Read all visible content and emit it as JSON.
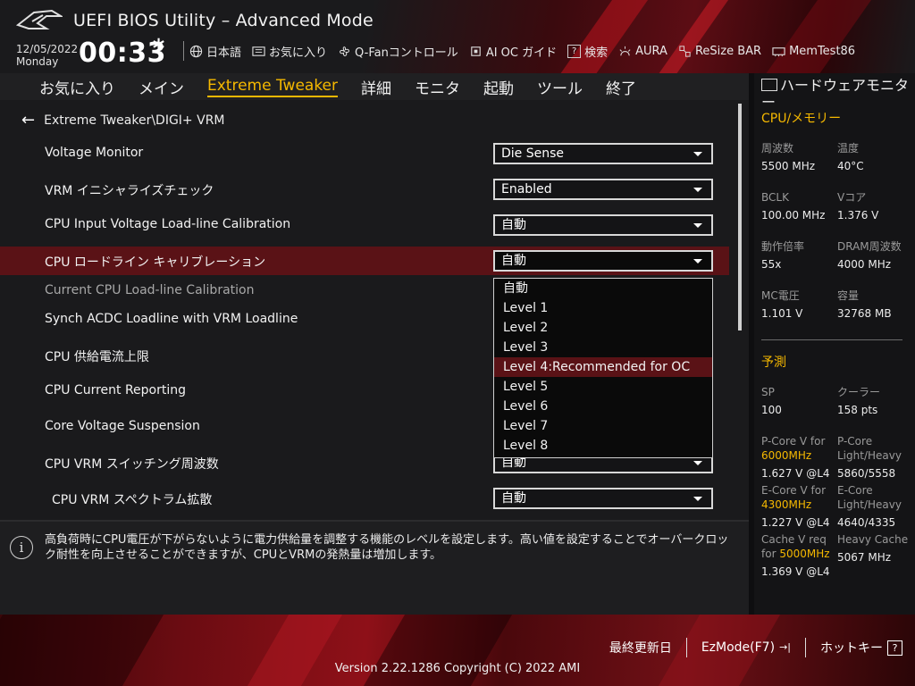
{
  "header": {
    "title": "UEFI BIOS Utility – Advanced Mode",
    "date": "12/05/2022",
    "day": "Monday",
    "time": "00:33",
    "toolbar": [
      {
        "icon": "globe-icon",
        "label": "日本語"
      },
      {
        "icon": "favorites-icon",
        "label": "お気に入り"
      },
      {
        "icon": "fan-icon",
        "label": "Q-Fanコントロール"
      },
      {
        "icon": "ai-oc-icon",
        "label": "AI OC ガイド"
      },
      {
        "icon": "help-box-icon",
        "glyph": "?",
        "label": "検索"
      },
      {
        "icon": "aura-icon",
        "label": "AURA"
      },
      {
        "icon": "resize-bar-icon",
        "label": "ReSize BAR"
      },
      {
        "icon": "memtest-icon",
        "label": "MemTest86"
      }
    ]
  },
  "menu": {
    "tabs": [
      "お気に入り",
      "メイン",
      "Extreme Tweaker",
      "詳細",
      "モニタ",
      "起動",
      "ツール",
      "終了"
    ],
    "active": "Extreme Tweaker"
  },
  "breadcrumb": "Extreme Tweaker\\DIGI+ VRM",
  "settings": [
    {
      "label": "Voltage Monitor",
      "value": "Die Sense"
    },
    {
      "label": "VRM イニシャライズチェック",
      "value": "Enabled"
    },
    {
      "label": "CPU Input Voltage Load-line Calibration",
      "value": "自動"
    },
    {
      "label": "CPU ロードライン キャリブレーション",
      "value": "自動"
    },
    {
      "label": "Current CPU Load-line Calibration",
      "value": ""
    },
    {
      "label": "Synch ACDC Loadline with VRM Loadline",
      "value": ""
    },
    {
      "label": "CPU 供給電流上限",
      "value": ""
    },
    {
      "label": "CPU Current Reporting",
      "value": ""
    },
    {
      "label": "Core Voltage Suspension",
      "value": ""
    },
    {
      "label": "CPU VRM スイッチング周波数",
      "value": "自動"
    },
    {
      "label": "CPU VRM スペクトラム拡散",
      "value": "自動"
    }
  ],
  "dropdown": {
    "options": [
      "自動",
      "Level 1",
      "Level 2",
      "Level 3",
      "Level 4:Recommended for OC",
      "Level 5",
      "Level 6",
      "Level 7",
      "Level 8"
    ],
    "hovered": "Level 4:Recommended for OC"
  },
  "help": {
    "text": "高負荷時にCPU電圧が下がらないように電力供給量を調整する機能のレベルを設定します。高い値を設定することでオーバークロック耐性を向上させることができますが、CPUとVRMの発熱量は増加します。"
  },
  "hardware_monitor": {
    "title": "ハードウェアモニター",
    "section_cpu": "CPU/メモリー",
    "cpu_stats": [
      {
        "k": "周波数",
        "v": "5500 MHz"
      },
      {
        "k": "温度",
        "v": "40°C"
      },
      {
        "k": "BCLK",
        "v": "100.00 MHz"
      },
      {
        "k": "Vコア",
        "v": "1.376 V"
      },
      {
        "k": "動作倍率",
        "v": "55x"
      },
      {
        "k": "DRAM周波数",
        "v": "4000 MHz"
      },
      {
        "k": "MC電圧",
        "v": "1.101 V"
      },
      {
        "k": "容量",
        "v": "32768 MB"
      }
    ],
    "section_predict": "予測",
    "sp_label": "SP",
    "sp_value": "100",
    "cooler_label": "クーラー",
    "cooler_value": "158 pts",
    "pcore_v_label": "P-Core V for",
    "pcore_v_freq": "6000MHz",
    "pcore_v_value": "1.627 V @L4",
    "pcore_lh_label1": "P-Core",
    "pcore_lh_label2": "Light/Heavy",
    "pcore_lh_value": "5860/5558",
    "ecore_v_label": "E-Core V for",
    "ecore_v_freq": "4300MHz",
    "ecore_v_value": "1.227 V @L4",
    "ecore_lh_label1": "E-Core",
    "ecore_lh_label2": "Light/Heavy",
    "ecore_lh_value": "4640/4335",
    "cache_v_label1": "Cache V req",
    "cache_v_label2": "for",
    "cache_v_freq": "5000MHz",
    "cache_v_value": "1.369 V @L4",
    "heavy_cache_label": "Heavy Cache",
    "heavy_cache_value": "5067 MHz"
  },
  "footer": {
    "last_updated": "最終更新日",
    "ezmode": "EzMode(F7)",
    "ezmode_glyph": "→|",
    "hotkey": "ホットキー",
    "hotkey_glyph": "?",
    "version": "Version 2.22.1286 Copyright (C) 2022 AMI"
  },
  "colors": {
    "accent": "#f5b800",
    "highlight_row": "#5a1216",
    "brand_red": "#8e1018"
  }
}
